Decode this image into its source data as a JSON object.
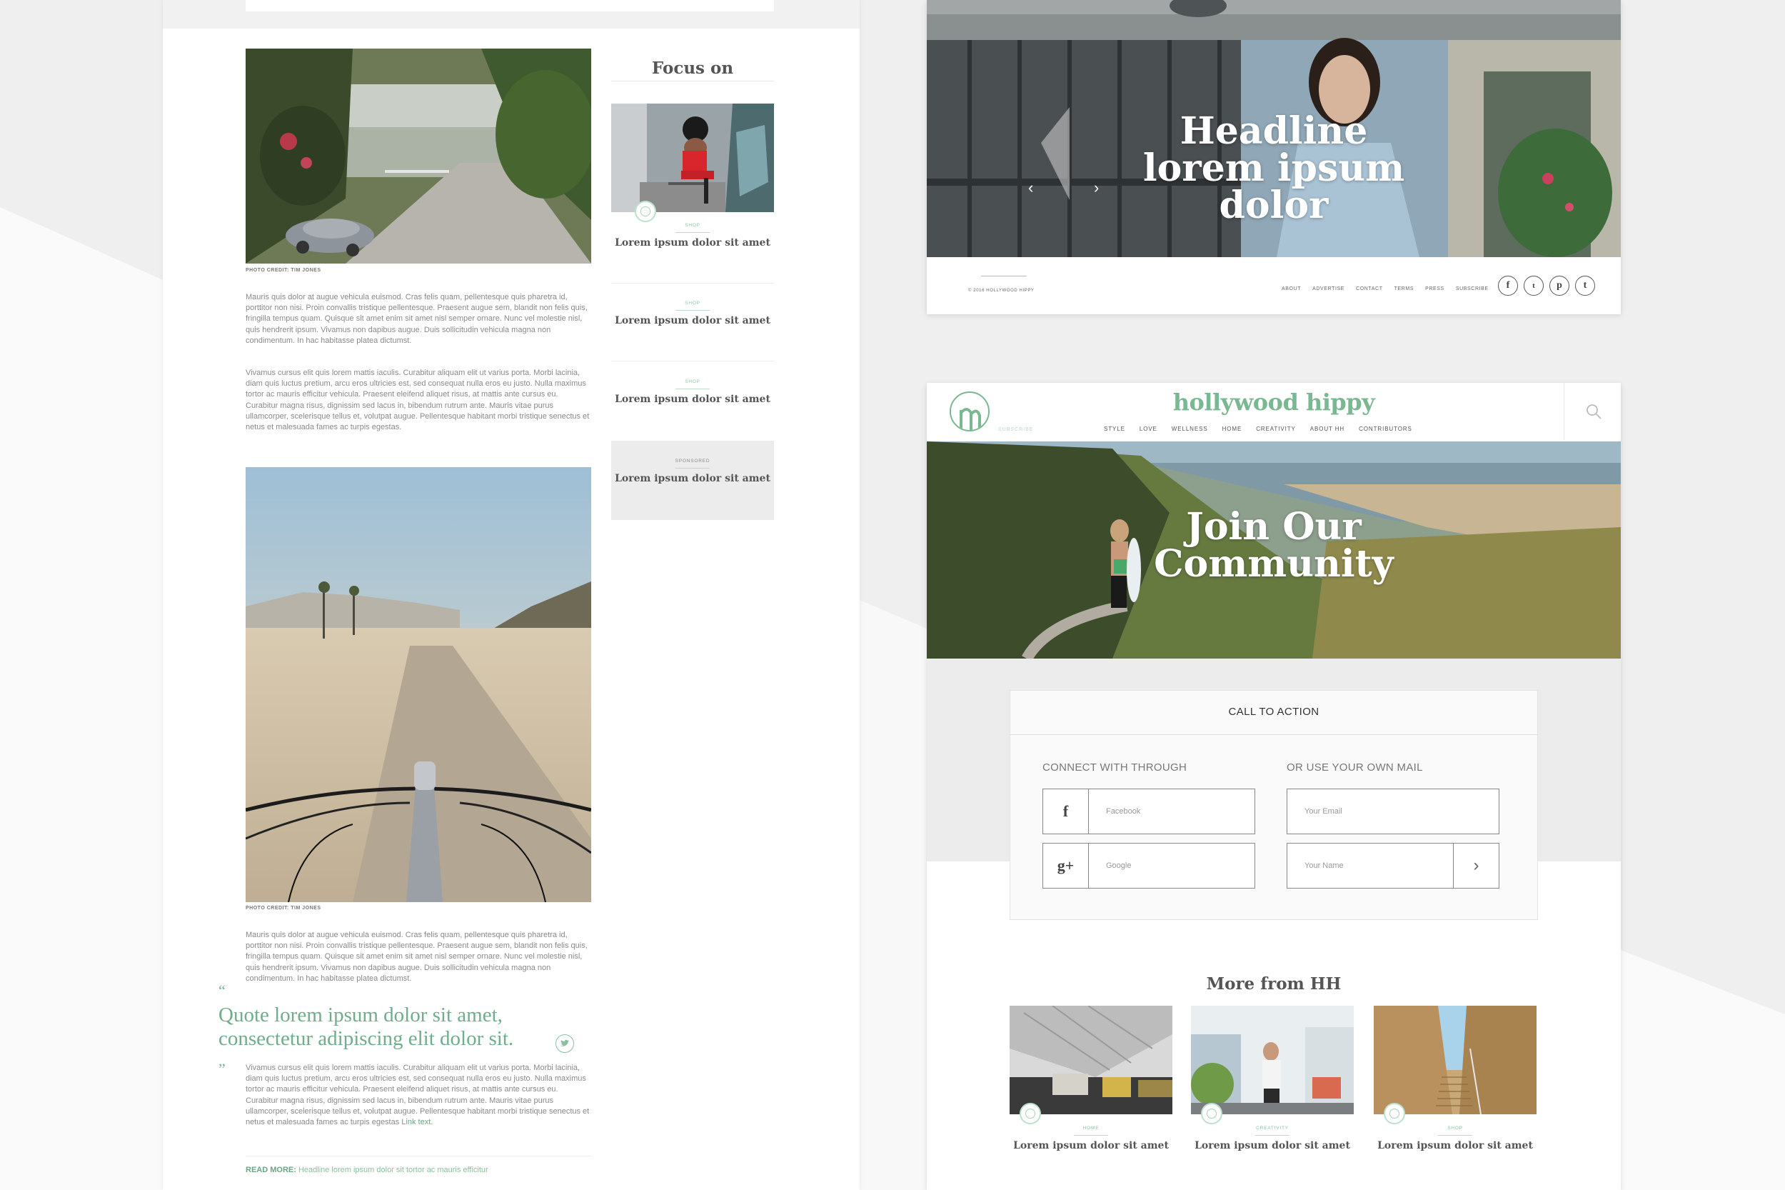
{
  "article": {
    "photo_credit_1": "PHOTO CREDIT: TIM JONES",
    "photo_credit_2": "PHOTO CREDIT: TIM JONES",
    "para_1": "Mauris quis dolor at augue vehicula euismod. Cras felis quam, pellentesque quis pharetra id, porttitor non nisi. Proin convallis tristique pellentesque. Praesent augue sem, blandit non felis quis, fringilla tempus quam. Quisque sit amet enim sit amet nisl semper ornare. Nunc vel molestie nisl, quis hendrerit ipsum. Vivamus non dapibus augue. Duis sollicitudin vehicula magna non condimentum. In hac habitasse platea dictumst.",
    "para_2": "Vivamus cursus elit quis lorem mattis iaculis. Curabitur aliquam elit ut varius porta. Morbi lacinia, diam quis luctus pretium, arcu eros ultricies est, sed consequat nulla eros eu justo. Nulla maximus tortor ac mauris efficitur vehicula. Praesent eleifend aliquet risus, at mattis ante cursus eu. Curabitur magna risus, dignissim sed lacus in, bibendum rutrum ante. Mauris vitae purus ullamcorper, scelerisque tellus et, volutpat augue. Pellentesque habitant morbi tristique senectus et netus et malesuada fames ac turpis egestas.",
    "para_3": "Mauris quis dolor at augue vehicula euismod. Cras felis quam, pellentesque quis pharetra id, porttitor non nisi. Proin convallis tristique pellentesque. Praesent augue sem, blandit non felis quis, fringilla tempus quam. Quisque sit amet enim sit amet nisl semper ornare. Nunc vel molestie nisl, quis hendrerit ipsum. Vivamus non dapibus augue. Duis sollicitudin vehicula magna non condimentum. In hac habitasse platea dictumst.",
    "quote_open": "“",
    "quote": "Quote lorem ipsum dolor sit amet, consectetur adipiscing elit dolor sit.",
    "quote_close": "”",
    "para_4": "Vivamus cursus elit quis lorem mattis iaculis. Curabitur aliquam elit ut varius porta. Morbi lacinia, diam quis luctus pretium, arcu eros ultricies est, sed consequat nulla eros eu justo. Nulla maximus tortor ac mauris efficitur vehicula. Praesent eleifend aliquet risus, at mattis ante cursus eu. Curabitur magna risus, dignissim sed lacus in, bibendum rutrum ante. Mauris vitae purus ullamcorper, scelerisque tellus et, volutpat augue. Pellentesque habitant morbi tristique senectus et netus et malesuada fames ac turpis egestas",
    "link_text": "Link text.",
    "read_more_label": "READ MORE:",
    "read_more_link": "Headline lorem ipsum dolor sit tortor ac mauris efficitur"
  },
  "focus": {
    "title": "Focus on",
    "items": [
      {
        "category": "SHOP",
        "title": "Lorem ipsum dolor sit amet"
      },
      {
        "category": "SHOP",
        "title": "Lorem ipsum dolor sit amet"
      },
      {
        "category": "SHOP",
        "title": "Lorem ipsum dolor sit amet"
      },
      {
        "category": "SPONSORED",
        "title": "Lorem ipsum dolor sit amet"
      }
    ]
  },
  "hero": {
    "headline": "Headline lorem ipsum dolor",
    "copyright": "© 2016 HOLLYWOOD HIPPY",
    "footer_links": [
      "ABOUT",
      "ADVERTISE",
      "CONTACT",
      "TERMS",
      "PRESS",
      "SUBSCRIBE"
    ],
    "social_icons": [
      "facebook-icon",
      "twitter-icon",
      "pinterest-icon",
      "tumblr-icon"
    ]
  },
  "community": {
    "logo_text": "hollywood hippy",
    "subscribe": "SUBSCRIBE",
    "nav": [
      "STYLE",
      "LOVE",
      "WELLNESS",
      "HOME",
      "CREATIVITY",
      "ABOUT HH",
      "CONTRIBUTORS"
    ],
    "banner_title": "Join Our Community",
    "cta_heading": "CALL TO ACTION",
    "connect_label": "CONNECT WITH THROUGH",
    "own_mail_label": "OR USE YOUR OWN MAIL",
    "facebook_placeholder": "Facebook",
    "google_placeholder": "Google",
    "email_placeholder": "Your Email",
    "name_placeholder": "Your Name",
    "more_title": "More from HH",
    "more_items": [
      {
        "category": "HOME",
        "title": "Lorem ipsum dolor sit amet"
      },
      {
        "category": "CREATIVITY",
        "title": "Lorem ipsum dolor sit amet"
      },
      {
        "category": "SHOP",
        "title": "Lorem ipsum dolor sit amet"
      }
    ]
  },
  "colors": {
    "accent_green": "#7ab891",
    "background": "#efefef"
  }
}
